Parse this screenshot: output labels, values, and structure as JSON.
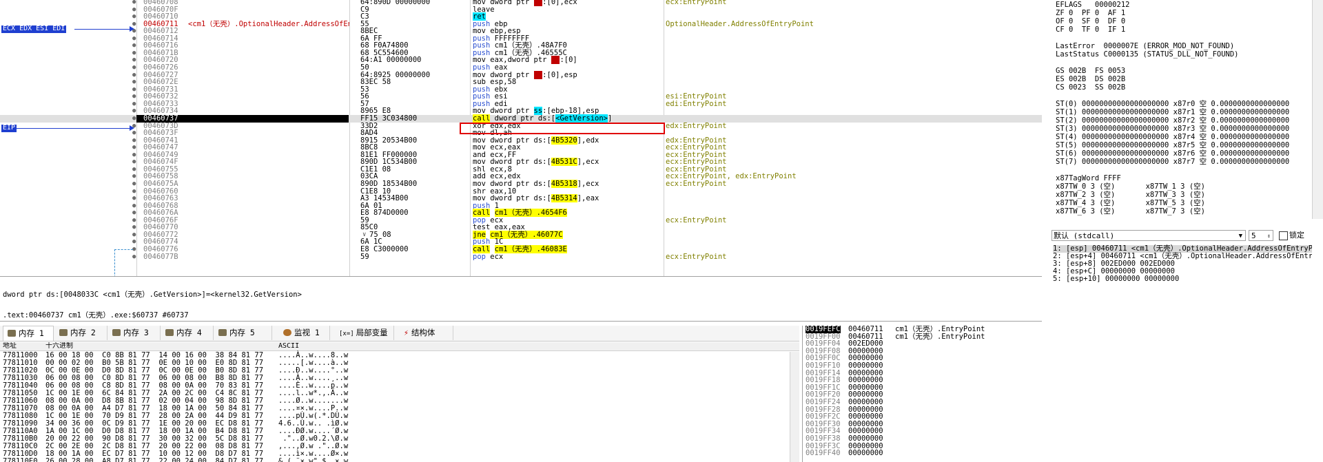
{
  "disasm": {
    "gutter_labels": [
      "ECX EDX ESI EDI",
      "EIP"
    ],
    "lines": [
      {
        "addr": "00460708",
        "bytes": "64:890D 00000000",
        "asm": "mov dword ptr fs:[0],ecx",
        "cmt": "ecx:EntryPoint"
      },
      {
        "addr": "0046070F",
        "bytes": "C9",
        "asm": "leave",
        "cmt": ""
      },
      {
        "addr": "00460710",
        "bytes": "C3",
        "asm": "ret",
        "cmt": ""
      },
      {
        "addr": "00460711",
        "label": "<cm1（无壳）.OptionalHeader.AddressOfEntryPoint>",
        "bytes": "55",
        "asm": "push ebp",
        "cmt": "OptionalHeader.AddressOfEntryPoint"
      },
      {
        "addr": "00460712",
        "bytes": "8BEC",
        "asm": "mov ebp,esp",
        "cmt": ""
      },
      {
        "addr": "00460714",
        "bytes": "6A FF",
        "asm": "push FFFFFFFF",
        "cmt": ""
      },
      {
        "addr": "00460716",
        "bytes": "68 F0A74800",
        "asm": "push cm1（无壳）.48A7F0",
        "cmt": ""
      },
      {
        "addr": "0046071B",
        "bytes": "68 5C554600",
        "asm": "push cm1（无壳）.46555C",
        "cmt": ""
      },
      {
        "addr": "00460720",
        "bytes": "64:A1 00000000",
        "asm": "mov eax,dword ptr fs:[0]",
        "cmt": ""
      },
      {
        "addr": "00460726",
        "bytes": "50",
        "asm": "push eax",
        "cmt": ""
      },
      {
        "addr": "00460727",
        "bytes": "64:8925 00000000",
        "asm": "mov dword ptr fs:[0],esp",
        "cmt": ""
      },
      {
        "addr": "0046072E",
        "bytes": "83EC 58",
        "asm": "sub esp,58",
        "cmt": ""
      },
      {
        "addr": "00460731",
        "bytes": "53",
        "asm": "push ebx",
        "cmt": ""
      },
      {
        "addr": "00460732",
        "bytes": "56",
        "asm": "push esi",
        "cmt": "esi:EntryPoint"
      },
      {
        "addr": "00460733",
        "bytes": "57",
        "asm": "push edi",
        "cmt": "edi:EntryPoint"
      },
      {
        "addr": "00460734",
        "bytes": "8965 E8",
        "asm": "mov dword ptr ss:[ebp-18],esp",
        "cmt": ""
      },
      {
        "addr": "00460737",
        "bytes": "FF15 3C034800",
        "asm": "call dword ptr ds:[<GetVersion>]",
        "cmt": ""
      },
      {
        "addr": "0046073D",
        "bytes": "33D2",
        "asm": "xor edx,edx",
        "cmt": "edx:EntryPoint"
      },
      {
        "addr": "0046073F",
        "bytes": "8AD4",
        "asm": "mov dl,ah",
        "cmt": ""
      },
      {
        "addr": "00460741",
        "bytes": "8915 20534B00",
        "asm": "mov dword ptr ds:[4B5320],edx",
        "cmt": "edx:EntryPoint"
      },
      {
        "addr": "00460747",
        "bytes": "8BC8",
        "asm": "mov ecx,eax",
        "cmt": "ecx:EntryPoint"
      },
      {
        "addr": "00460749",
        "bytes": "81E1 FF000000",
        "asm": "and ecx,FF",
        "cmt": "ecx:EntryPoint"
      },
      {
        "addr": "0046074F",
        "bytes": "890D 1C534B00",
        "asm": "mov dword ptr ds:[4B531C],ecx",
        "cmt": "ecx:EntryPoint"
      },
      {
        "addr": "00460755",
        "bytes": "C1E1 08",
        "asm": "shl ecx,8",
        "cmt": "ecx:EntryPoint"
      },
      {
        "addr": "00460758",
        "bytes": "03CA",
        "asm": "add ecx,edx",
        "cmt": "ecx:EntryPoint, edx:EntryPoint"
      },
      {
        "addr": "0046075A",
        "bytes": "890D 18534B00",
        "asm": "mov dword ptr ds:[4B5318],ecx",
        "cmt": "ecx:EntryPoint"
      },
      {
        "addr": "00460760",
        "bytes": "C1E8 10",
        "asm": "shr eax,10",
        "cmt": ""
      },
      {
        "addr": "00460763",
        "bytes": "A3 14534B00",
        "asm": "mov dword ptr ds:[4B5314],eax",
        "cmt": ""
      },
      {
        "addr": "00460768",
        "bytes": "6A 01",
        "asm": "push 1",
        "cmt": ""
      },
      {
        "addr": "0046076A",
        "bytes": "E8 874D0000",
        "asm": "call cm1（无壳）.4654F6",
        "cmt": ""
      },
      {
        "addr": "0046076F",
        "bytes": "59",
        "asm": "pop ecx",
        "cmt": "ecx:EntryPoint"
      },
      {
        "addr": "00460770",
        "bytes": "85C0",
        "asm": "test eax,eax",
        "cmt": ""
      },
      {
        "addr": "00460772",
        "bytes": "75 08",
        "asm": "jne cm1（无壳）.46077C",
        "cmt": ""
      },
      {
        "addr": "00460774",
        "bytes": "6A 1C",
        "asm": "push 1C",
        "cmt": ""
      },
      {
        "addr": "00460776",
        "bytes": "E8 C3000000",
        "asm": "call cm1（无壳）.46083E",
        "cmt": ""
      },
      {
        "addr": "0046077B",
        "bytes": "59",
        "asm": "pop ecx",
        "cmt": "ecx:EntryPoint"
      }
    ]
  },
  "info": {
    "line1": "dword ptr ds:[0048033C <cm1（无壳）.GetVersion>]=<kernel32.GetVersion>",
    "line2": ".text:00460737 cm1（无壳）.exe:$60737 #60737"
  },
  "registers": [
    "EFLAGS   00000212",
    "ZF 0  PF 0  AF 1",
    "OF 0  SF 0  DF 0",
    "CF 0  TF 0  IF 1",
    "",
    "LastError  0000007E (ERROR_MOD_NOT_FOUND)",
    "LastStatus C0000135 (STATUS_DLL_NOT_FOUND)",
    "",
    "GS 002B  FS 0053",
    "ES 002B  DS 002B",
    "CS 0023  SS 002B",
    "",
    "ST(0) 00000000000000000000 x87r0 空 0.0000000000000000",
    "ST(1) 00000000000000000000 x87r1 空 0.0000000000000000",
    "ST(2) 00000000000000000000 x87r2 空 0.0000000000000000",
    "ST(3) 00000000000000000000 x87r3 空 0.0000000000000000",
    "ST(4) 00000000000000000000 x87r4 空 0.0000000000000000",
    "ST(5) 00000000000000000000 x87r5 空 0.0000000000000000",
    "ST(6) 00000000000000000000 x87r6 空 0.0000000000000000",
    "ST(7) 00000000000000000000 x87r7 空 0.0000000000000000",
    "",
    "x87TagWord FFFF",
    "x87TW_0 3 (空)       x87TW_1 3 (空)",
    "x87TW_2 3 (空)       x87TW_3 3 (空)",
    "x87TW_4 3 (空)       x87TW_5 3 (空)",
    "x87TW_6 3 (空)       x87TW_7 3 (空)"
  ],
  "callconv": {
    "selected": "默认 (stdcall)",
    "argcount": "5",
    "lock_label": "锁定"
  },
  "args": [
    "1: [esp] 00460711 <cm1（无壳）.OptionalHeader.AddressOfEntryPoint>",
    "2: [esp+4] 00460711 <cm1（无壳）.OptionalHeader.AddressOfEntryPoint>",
    "3: [esp+8] 002ED000 002ED000",
    "4: [esp+C] 00000000 00000000",
    "5: [esp+10] 00000000 00000000"
  ],
  "tabs": [
    "内存 1",
    "内存 2",
    "内存 3",
    "内存 4",
    "内存 5",
    "监视 1",
    "局部变量",
    "结构体"
  ],
  "tab_prefix_locals": "[x=]",
  "dump": {
    "hdr_addr": "地址",
    "hdr_hex": "十六进制",
    "hdr_ascii": "ASCII",
    "rows": [
      {
        "a": "77811000",
        "h": "16 00 18 00  C0 8B 81 77  14 00 16 00  38 84 81 77",
        "s": "....À..w....8..w"
      },
      {
        "a": "77811010",
        "h": "00 00 02 00  B0 5B 81 77  0E 00 10 00  E0 8D 81 77",
        "s": ".....[.w....à..w"
      },
      {
        "a": "77811020",
        "h": "0C 00 0E 00  D0 8D 81 77  0C 00 0E 00  B0 8D 81 77",
        "s": "....Ð..w....°..w"
      },
      {
        "a": "77811030",
        "h": "06 00 08 00  C0 8D 81 77  06 00 08 00  B8 8D 81 77",
        "s": "....À..w....¸..w"
      },
      {
        "a": "77811040",
        "h": "06 00 08 00  C8 8D 81 77  08 00 0A 00  70 83 81 77",
        "s": "....È..w....p..w"
      },
      {
        "a": "77811050",
        "h": "1C 00 1E 00  6C 84 81 77  2A 00 2C 00  C4 8C 81 77",
        "s": "....l..w*.,.Ä..w"
      },
      {
        "a": "77811060",
        "h": "08 00 0A 00  D8 8B 81 77  02 00 04 00  98 8D 81 77",
        "s": "....Ø..w.......w"
      },
      {
        "a": "77811070",
        "h": "08 00 0A 00  A4 D7 81 77  18 00 1A 00  50 84 81 77",
        "s": "....¤×.w....P..w"
      },
      {
        "a": "77811080",
        "h": "1C 00 1E 00  70 D9 81 77  28 00 2A 00  44 D9 81 77",
        "s": "....pÙ.w(.*.DÙ.w"
      },
      {
        "a": "77811090",
        "h": "34 00 36 00  0C D9 81 77  1E 00 20 00  EC D8 81 77",
        "s": "4.6..Ù.w.. .ìØ.w"
      },
      {
        "a": "778110A0",
        "h": "1A 00 1C 00  D0 D8 81 77  18 00 1A 00  B4 D8 81 77",
        "s": "....ÐØ.w....´Ø.w"
      },
      {
        "a": "778110B0",
        "h": "20 00 22 00  90 D8 81 77  30 00 32 00  5C D8 81 77",
        "s": " .\"..Ø.w0.2.\\Ø.w"
      },
      {
        "a": "778110C0",
        "h": "2C 00 2E 00  2C D8 81 77  20 00 22 00  08 D8 81 77",
        "s": ",...,Ø.w .\"..Ø.w"
      },
      {
        "a": "778110D0",
        "h": "18 00 1A 00  EC D7 81 77  10 00 12 00  D8 D7 81 77",
        "s": "....ì×.w....Ø×.w"
      },
      {
        "a": "778110E0",
        "h": "26 00 28 00  A8 D7 81 77  22 00 24 00  84 D7 81 77",
        "s": "&.(.¨×.w\".$..×.w"
      }
    ]
  },
  "stack": [
    {
      "a": "0019FEFC",
      "v": "00460711",
      "c": "cm1（无壳）.EntryPoint"
    },
    {
      "a": "0019FF00",
      "v": "00460711",
      "c": "cm1（无壳）.EntryPoint"
    },
    {
      "a": "0019FF04",
      "v": "002ED000",
      "c": ""
    },
    {
      "a": "0019FF08",
      "v": "00000000",
      "c": ""
    },
    {
      "a": "0019FF0C",
      "v": "00000000",
      "c": ""
    },
    {
      "a": "0019FF10",
      "v": "00000000",
      "c": ""
    },
    {
      "a": "0019FF14",
      "v": "00000000",
      "c": ""
    },
    {
      "a": "0019FF18",
      "v": "00000000",
      "c": ""
    },
    {
      "a": "0019FF1C",
      "v": "00000000",
      "c": ""
    },
    {
      "a": "0019FF20",
      "v": "00000000",
      "c": ""
    },
    {
      "a": "0019FF24",
      "v": "00000000",
      "c": ""
    },
    {
      "a": "0019FF28",
      "v": "00000000",
      "c": ""
    },
    {
      "a": "0019FF2C",
      "v": "00000000",
      "c": ""
    },
    {
      "a": "0019FF30",
      "v": "00000000",
      "c": ""
    },
    {
      "a": "0019FF34",
      "v": "00000000",
      "c": ""
    },
    {
      "a": "0019FF38",
      "v": "00000000",
      "c": ""
    },
    {
      "a": "0019FF3C",
      "v": "00000000",
      "c": ""
    },
    {
      "a": "0019FF40",
      "v": "00000000",
      "c": ""
    }
  ]
}
